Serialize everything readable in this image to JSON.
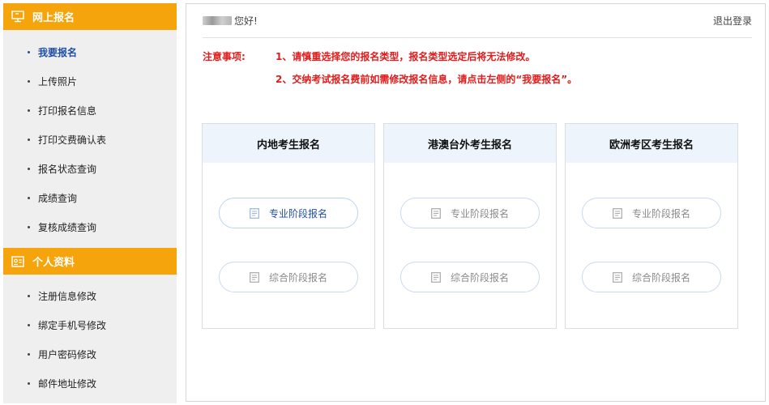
{
  "sidebar": {
    "section1": {
      "title": "网上报名",
      "icon": "monitor-icon",
      "items": [
        {
          "label": "我要报名",
          "active": true
        },
        {
          "label": "上传照片"
        },
        {
          "label": "打印报名信息"
        },
        {
          "label": "打印交费确认表"
        },
        {
          "label": "报名状态查询"
        },
        {
          "label": "成绩查询"
        },
        {
          "label": "复核成绩查询"
        }
      ]
    },
    "section2": {
      "title": "个人资料",
      "icon": "id-card-icon",
      "items": [
        {
          "label": "注册信息修改"
        },
        {
          "label": "绑定手机号修改"
        },
        {
          "label": "用户密码修改"
        },
        {
          "label": "邮件地址修改"
        }
      ]
    }
  },
  "header": {
    "greeting": "您好!",
    "logout": "退出登录"
  },
  "notice": {
    "label": "注意事项:",
    "line1": "1、请慎重选择您的报名类型，报名类型选定后将无法修改。",
    "line2": "2、交纳考试报名费前如需修改报名信息，请点击左侧的“我要报名”。"
  },
  "cards": [
    {
      "title": "内地考生报名",
      "btn1": "专业阶段报名",
      "btn2": "综合阶段报名"
    },
    {
      "title": "港澳台外考生报名",
      "btn1": "专业阶段报名",
      "btn2": "综合阶段报名"
    },
    {
      "title": "欧洲考区考生报名",
      "btn1": "专业阶段报名",
      "btn2": "综合阶段报名"
    }
  ],
  "colors": {
    "accent": "#f6a40c",
    "notice": "#e21b1b",
    "link": "#1f4fa8"
  }
}
